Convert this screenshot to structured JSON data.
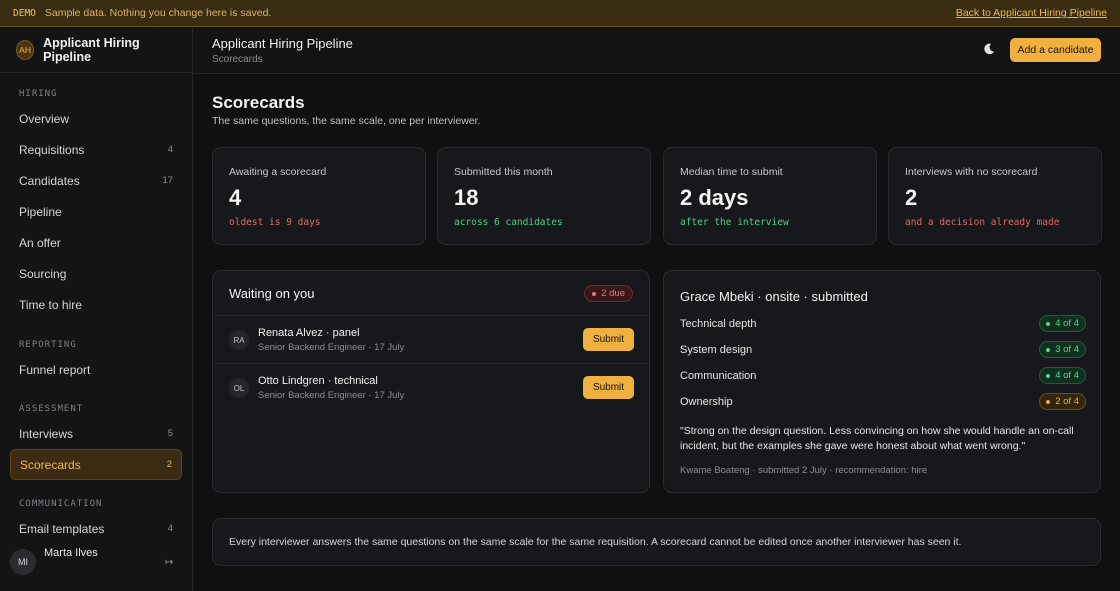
{
  "banner": {
    "tag": "DEMO",
    "message": "Sample data. Nothing you change here is saved.",
    "back_link": "Back to Applicant Hiring Pipeline"
  },
  "brand": {
    "initials": "AH",
    "name": "Applicant Hiring Pipeline"
  },
  "sidebar": {
    "sections": [
      {
        "label": "HIRING",
        "items": [
          {
            "label": "Overview",
            "count": ""
          },
          {
            "label": "Requisitions",
            "count": "4"
          },
          {
            "label": "Candidates",
            "count": "17"
          },
          {
            "label": "Pipeline",
            "count": ""
          },
          {
            "label": "An offer",
            "count": ""
          },
          {
            "label": "Sourcing",
            "count": ""
          },
          {
            "label": "Time to hire",
            "count": ""
          }
        ]
      },
      {
        "label": "REPORTING",
        "items": [
          {
            "label": "Funnel report",
            "count": ""
          }
        ]
      },
      {
        "label": "ASSESSMENT",
        "items": [
          {
            "label": "Interviews",
            "count": "5"
          },
          {
            "label": "Scorecards",
            "count": "2",
            "active": true
          }
        ]
      },
      {
        "label": "COMMUNICATION",
        "items": [
          {
            "label": "Email templates",
            "count": "4"
          }
        ]
      }
    ],
    "user": {
      "initials": "MI",
      "name": "Marta Ilves"
    }
  },
  "topbar": {
    "title": "Applicant Hiring Pipeline",
    "breadcrumb": "Scorecards",
    "add_button": "Add a candidate"
  },
  "page": {
    "title": "Scorecards",
    "subtitle": "The same questions, the same scale, one per interviewer."
  },
  "stats": [
    {
      "label": "Awaiting a scorecard",
      "value": "4",
      "note": "oldest is 9 days",
      "tone": "red"
    },
    {
      "label": "Submitted this month",
      "value": "18",
      "note": "across 6 candidates",
      "tone": "green"
    },
    {
      "label": "Median time to submit",
      "value": "2 days",
      "note": "after the interview",
      "tone": "green"
    },
    {
      "label": "Interviews with no scorecard",
      "value": "2",
      "note": "and a decision already made",
      "tone": "red"
    }
  ],
  "waiting": {
    "title": "Waiting on you",
    "due_badge": "2 due",
    "rows": [
      {
        "initials": "RA",
        "name": "Renata Alvez · panel",
        "sub": "Senior Backend Engineer · 17 July",
        "button": "Submit"
      },
      {
        "initials": "OL",
        "name": "Otto Lindgren · technical",
        "sub": "Senior Backend Engineer · 17 July",
        "button": "Submit"
      }
    ]
  },
  "scorecard": {
    "title": "Grace Mbeki · onsite · submitted",
    "scores": [
      {
        "question": "Technical depth",
        "score": "4 of 4",
        "tone": "green"
      },
      {
        "question": "System design",
        "score": "3 of 4",
        "tone": "green"
      },
      {
        "question": "Communication",
        "score": "4 of 4",
        "tone": "green"
      },
      {
        "question": "Ownership",
        "score": "2 of 4",
        "tone": "amber"
      }
    ],
    "quote": "\"Strong on the design question. Less convincing on how she would handle an on-call incident, but the examples she gave were honest about what went wrong.\"",
    "meta": "Kwame Boateng · submitted 2 July · recommendation: hire"
  },
  "footer_note": "Every interviewer answers the same questions on the same scale for the same requisition. A scorecard cannot be edited once another interviewer has seen it."
}
